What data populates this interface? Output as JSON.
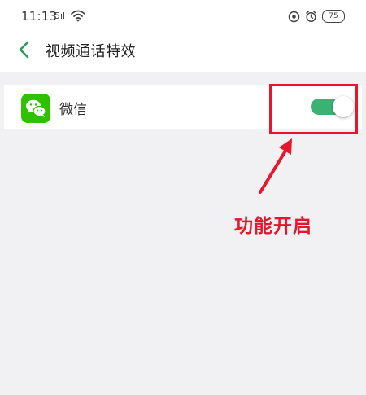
{
  "status_bar": {
    "time": "11:13",
    "signal": "5ıl",
    "battery": "75",
    "icons": [
      "wifi-icon",
      "location-icon",
      "alarm-icon"
    ]
  },
  "nav": {
    "back_icon": "chevron-left-icon",
    "title": "视频通话特效"
  },
  "app_row": {
    "icon": "wechat-icon",
    "name": "微信",
    "toggle_on": true,
    "toggle_color": "#3bb273"
  },
  "annotation": {
    "text": "功能开启",
    "color": "#e8162c"
  },
  "colors": {
    "background": "#f1f1f3",
    "accent_green": "#3bb273",
    "wechat_green": "#2dc100"
  }
}
